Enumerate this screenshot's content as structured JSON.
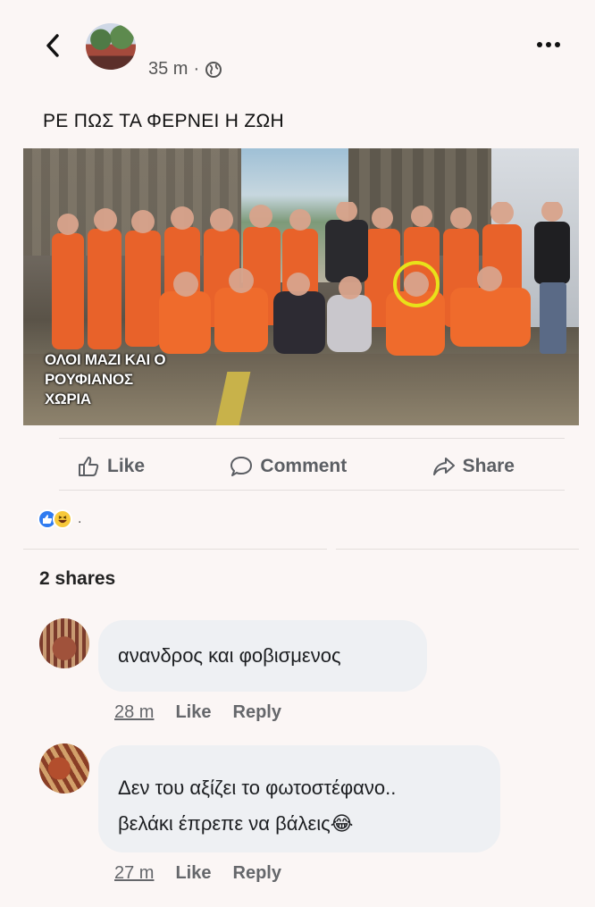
{
  "header": {
    "time": "35 m",
    "separator": "·",
    "back_icon": "chevron-left-icon",
    "privacy_icon": "globe-icon",
    "more_icon": "more-horizontal-icon"
  },
  "post": {
    "text": "ΡΕ ΠΩΣ ΤΑ ΦΕΡΝΕΙ Η  ΖΩΗ",
    "photo_caption": [
      "ΟΛΟΙ ΜΑΖΙ ΚΑΙ Ο",
      "ΡΟΥΦΙΑΝΟΣ",
      "ΧΩΡΙΑ"
    ]
  },
  "actions": {
    "like": "Like",
    "comment": "Comment",
    "share": "Share"
  },
  "reactions": {
    "types": [
      "like",
      "haha"
    ],
    "count": "."
  },
  "shares": "2 shares",
  "comments": [
    {
      "text": "ανανδρος και φοβισμενος",
      "time": "28 m",
      "like": "Like",
      "reply": "Reply"
    },
    {
      "text_line1": "Δεν του αξίζει το φωτοστέφανο..",
      "text_line2": "βελάκι έπρεπε να βάλεις",
      "emoji": "😂",
      "time": "27 m",
      "like": "Like",
      "reply": "Reply"
    }
  ],
  "colors": {
    "background": "#fbf6f5",
    "bubble": "#eef0f3",
    "like_blue": "#2f7bf0",
    "haha_yellow": "#f7c93a",
    "halo_yellow": "#e8e21a",
    "uniform_orange": "#e8622a"
  }
}
